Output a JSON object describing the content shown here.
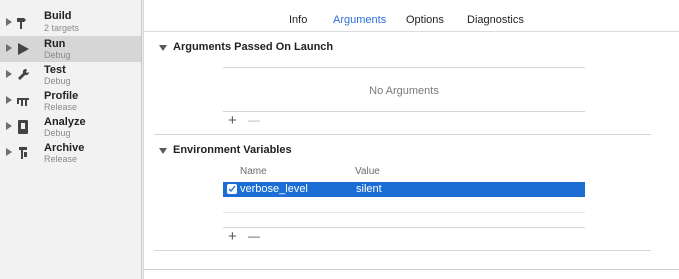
{
  "sidebar": {
    "items": [
      {
        "label": "Build",
        "sub": "2 targets",
        "icon": "hammer-icon"
      },
      {
        "label": "Run",
        "sub": "Debug",
        "icon": "play-icon"
      },
      {
        "label": "Test",
        "sub": "Debug",
        "icon": "wrench-icon"
      },
      {
        "label": "Profile",
        "sub": "Release",
        "icon": "instruments-icon"
      },
      {
        "label": "Analyze",
        "sub": "Debug",
        "icon": "analyze-icon"
      },
      {
        "label": "Archive",
        "sub": "Release",
        "icon": "archive-icon"
      }
    ],
    "selected_index": 1
  },
  "tabs": [
    {
      "label": "Info"
    },
    {
      "label": "Arguments"
    },
    {
      "label": "Options"
    },
    {
      "label": "Diagnostics"
    }
  ],
  "active_tab": "Arguments",
  "arguments_section": {
    "title": "Arguments Passed On Launch",
    "empty_text": "No Arguments",
    "add_label": "+",
    "remove_label": "—"
  },
  "env_section": {
    "title": "Environment Variables",
    "columns": {
      "name": "Name",
      "value": "Value"
    },
    "rows": [
      {
        "enabled": true,
        "name": "verbose_level",
        "value": "silent"
      }
    ],
    "add_label": "+",
    "remove_label": "—"
  },
  "colors": {
    "accent": "#2b6fd9",
    "selection": "#1c6ed5",
    "sidebar_selected": "#d6d6d6"
  }
}
